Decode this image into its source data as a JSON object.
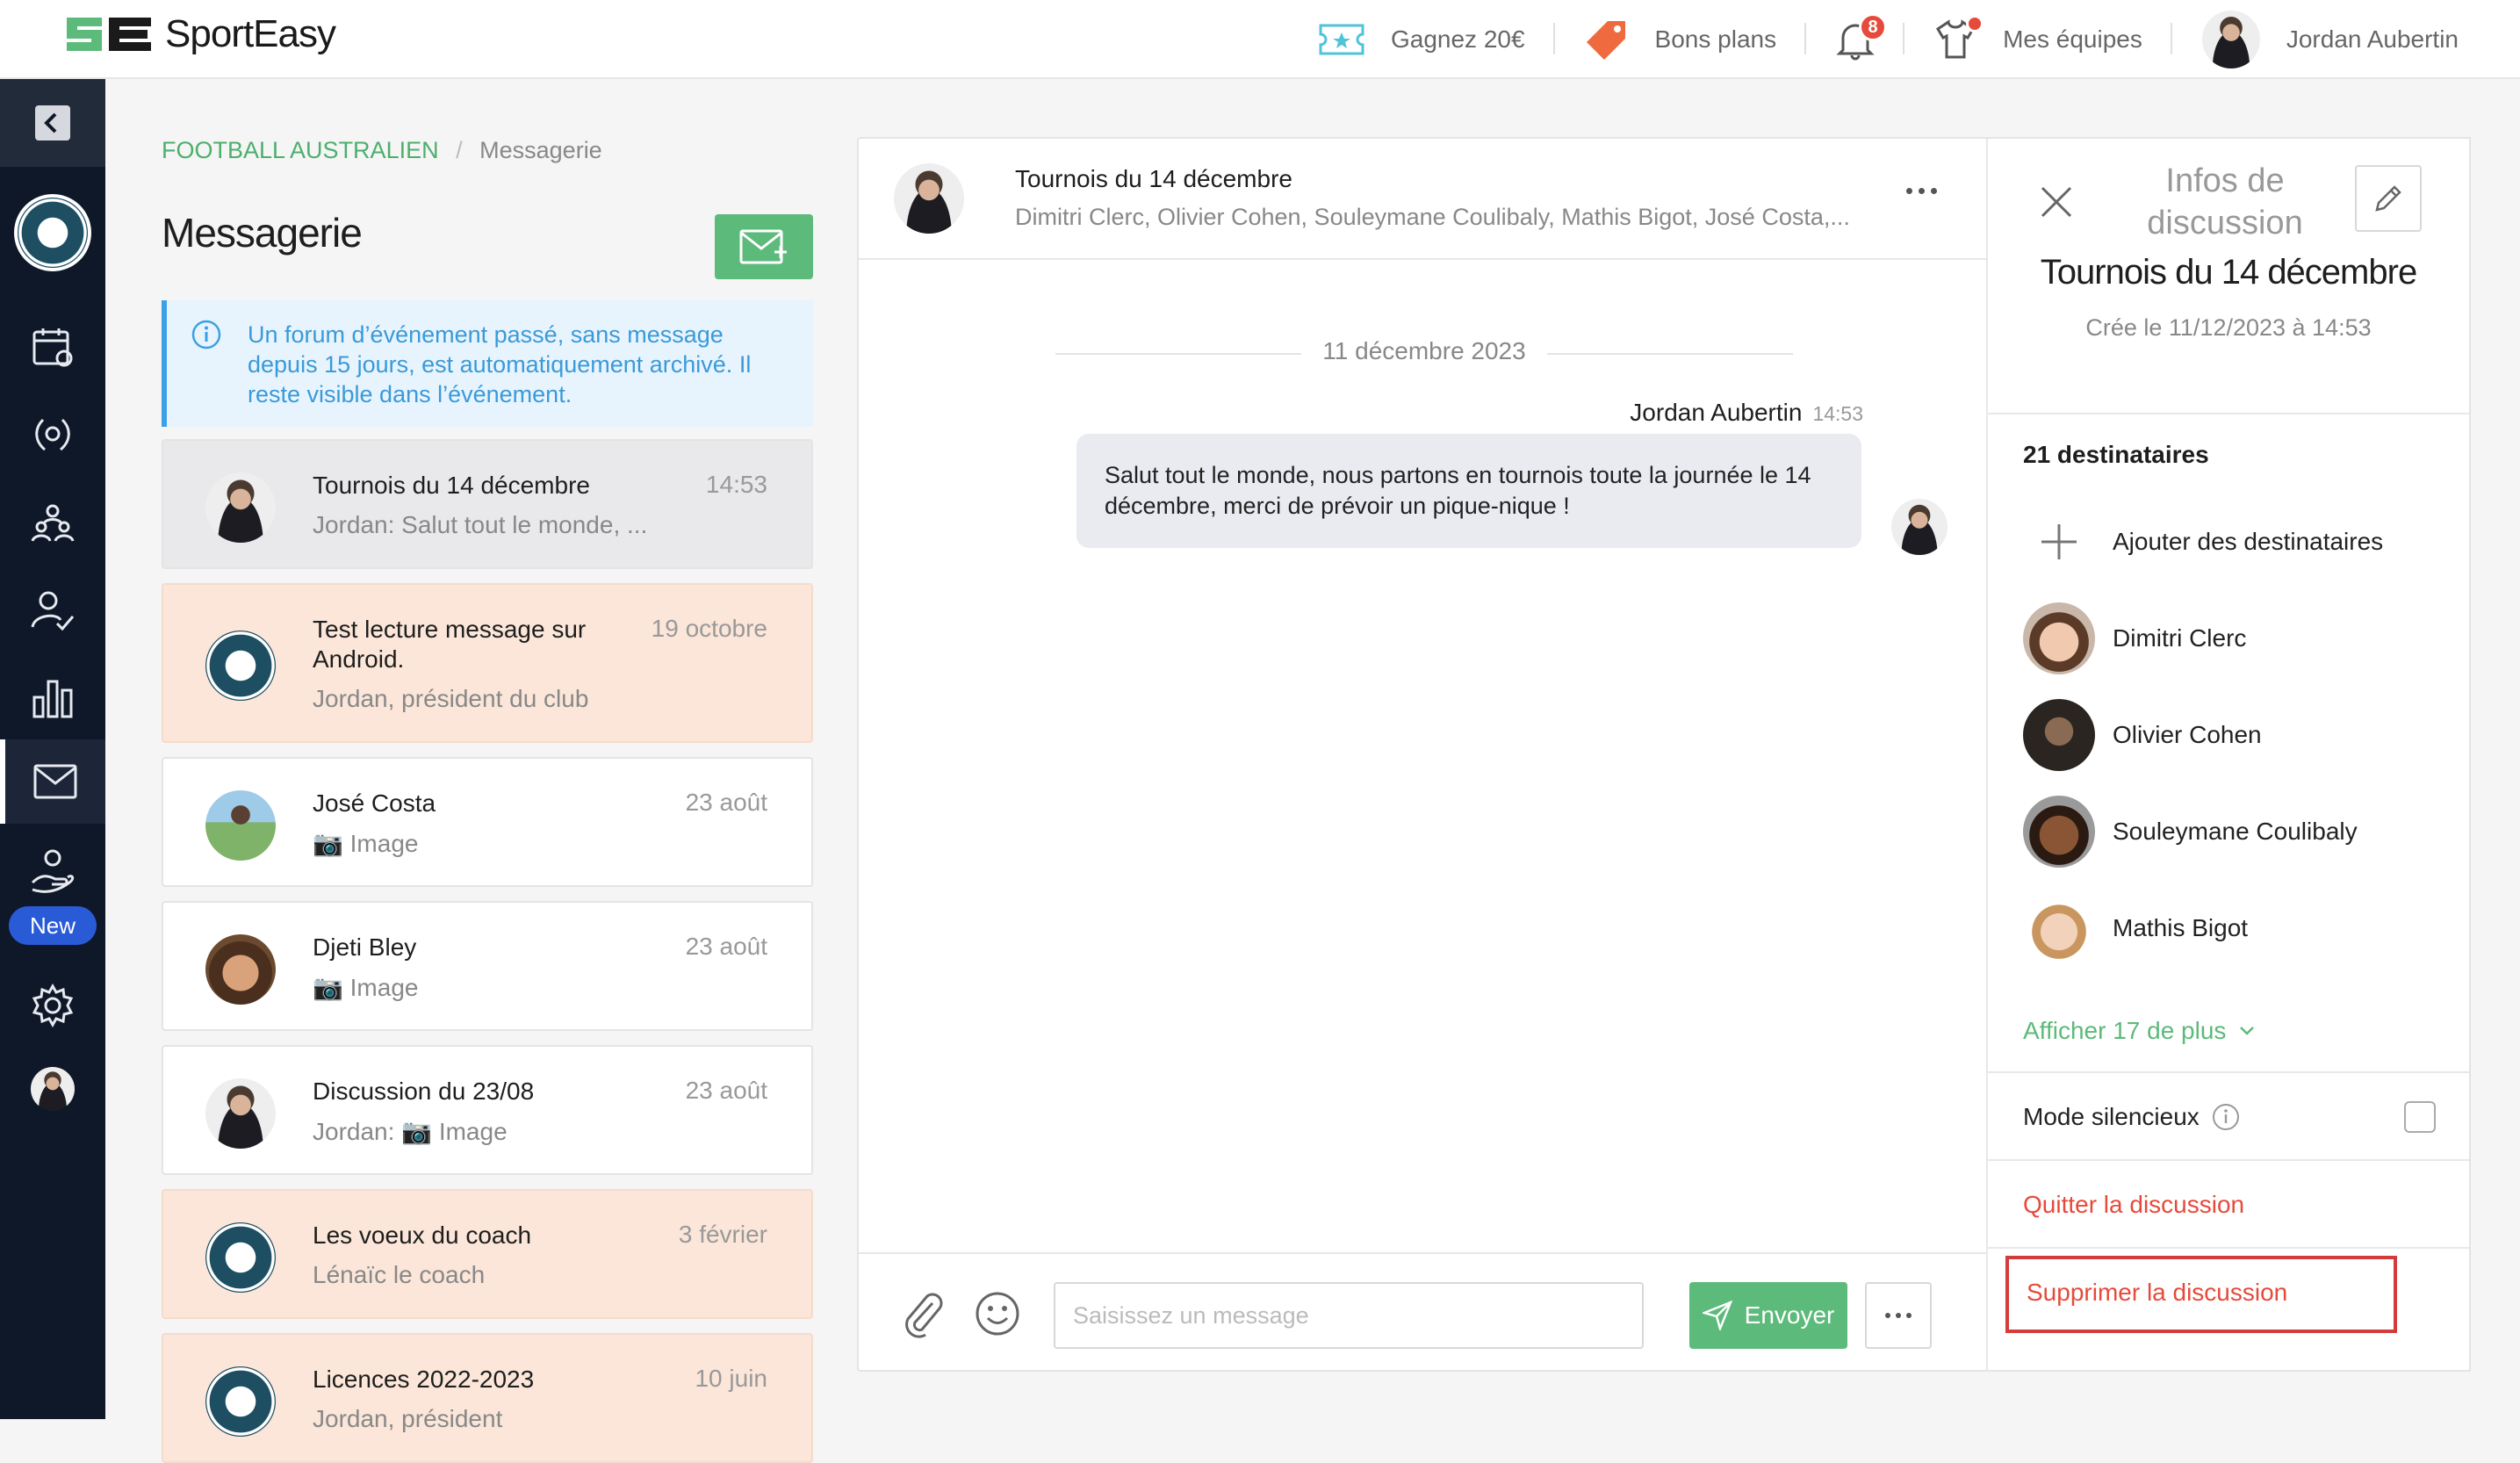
{
  "brand": {
    "name": "SportEasy",
    "colors": {
      "green": "#5cba7a",
      "navy": "#0f1828",
      "red": "#e64a3b",
      "blue": "#3aa0e8"
    }
  },
  "topnav": {
    "promo": {
      "label": "Gagnez 20€",
      "icon": "ticket-icon"
    },
    "deals": {
      "label": "Bons plans",
      "icon": "tag-icon"
    },
    "notifications": {
      "icon": "bell-icon",
      "count": "8"
    },
    "teams": {
      "label": "Mes équipes",
      "icon": "jersey-icon"
    },
    "user": {
      "name": "Jordan Aubertin"
    }
  },
  "sidebar": {
    "new_label": "New"
  },
  "breadcrumb": {
    "section": "FOOTBALL AUSTRALIEN",
    "separator": "/",
    "page": "Messagerie"
  },
  "page_title": "Messagerie",
  "info_notice": "Un forum d’événement passé, sans message depuis 15 jours, est automatiquement archivé. Il reste visible dans l’événement.",
  "conversations": [
    {
      "title": "Tournois du 14 décembre",
      "date": "14:53",
      "snippet": "Jordan: Salut tout le monde, ..."
    },
    {
      "title": "Test lecture message sur Android.",
      "date": "19 octobre",
      "snippet": "Jordan, président du club"
    },
    {
      "title": "José Costa",
      "date": "23 août",
      "snippet": "📷 Image"
    },
    {
      "title": "Djeti Bley",
      "date": "23 août",
      "snippet": "📷 Image"
    },
    {
      "title": "Discussion du 23/08",
      "date": "23 août",
      "snippet": "Jordan: 📷 Image"
    },
    {
      "title": "Les voeux du coach",
      "date": "3 février",
      "snippet": "Lénaïc le coach"
    },
    {
      "title": "Licences 2022-2023",
      "date": "10 juin",
      "snippet": "Jordan, président"
    }
  ],
  "chat": {
    "title": "Tournois du 14 décembre",
    "members": "Dimitri Clerc, Olivier Cohen, Souleymane Coulibaly, Mathis Bigot, José Costa,...",
    "date_separator": "11 décembre 2023",
    "message": {
      "author": "Jordan Aubertin",
      "time": "14:53",
      "text": "Salut tout le monde, nous partons en tournois toute la journée le 14 décembre, merci de prévoir un pique-nique !"
    },
    "composer": {
      "placeholder": "Saisissez un message",
      "send_label": "Envoyer"
    }
  },
  "info_panel": {
    "header": "Infos de discussion",
    "title": "Tournois du 14 décembre",
    "created": "Crée le 11/12/2023 à 14:53",
    "recipients_count": "21 destinataires",
    "add_recipients": "Ajouter des destinataires",
    "recipients": [
      "Dimitri Clerc",
      "Olivier Cohen",
      "Souleymane Coulibaly",
      "Mathis Bigot"
    ],
    "show_more": "Afficher 17 de plus",
    "mute_label": "Mode silencieux",
    "mute_checked": false,
    "leave": "Quitter la discussion",
    "delete": "Supprimer la discussion"
  }
}
